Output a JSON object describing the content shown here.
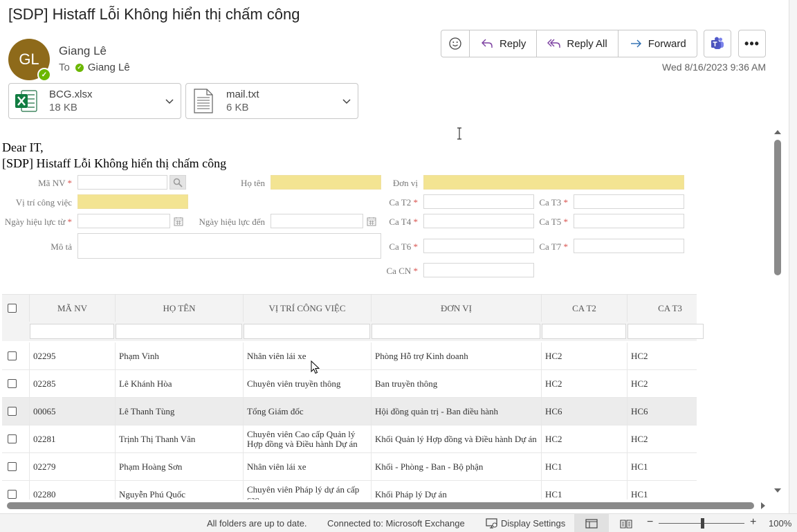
{
  "email": {
    "subject": "[SDP] Histaff Lỗi Không hiển thị chấm công",
    "avatar_initials": "GL",
    "sender": "Giang Lê",
    "to_label": "To",
    "to_name": "Giang Lê",
    "date": "Wed 8/16/2023 9:36 AM"
  },
  "actions": {
    "emoji_icon": "smiley-icon",
    "reply": "Reply",
    "reply_all": "Reply All",
    "forward": "Forward",
    "teams_icon": "teams-icon",
    "more": "•••"
  },
  "attachments": [
    {
      "name": "BCG.xlsx",
      "size": "18 KB",
      "icon": "excel-icon"
    },
    {
      "name": "mail.txt",
      "size": "6 KB",
      "icon": "text-file-icon"
    }
  ],
  "body": {
    "greeting": "Dear IT,",
    "subject_line": "[SDP] Histaff Lỗi Không hiển thị chấm công"
  },
  "form": {
    "ma_nv": "Mã NV",
    "ho_ten": "Họ tên",
    "don_vi": "Đơn vị",
    "vi_tri": "Vị trí công việc",
    "ca_t2": "Ca T2",
    "ca_t3": "Ca T3",
    "hieu_luc_tu": "Ngày hiệu lực từ",
    "hieu_luc_den": "Ngày hiệu lực đến",
    "ca_t4": "Ca T4",
    "ca_t5": "Ca T5",
    "mo_ta": "Mô tả",
    "ca_t6": "Ca T6",
    "ca_t7": "Ca T7",
    "ca_cn": "Ca CN",
    "required_mark": "*"
  },
  "grid": {
    "columns": [
      "MÃ NV",
      "HỌ TÊN",
      "VỊ TRÍ CÔNG VIỆC",
      "ĐƠN VỊ",
      "CA T2",
      "CA T3"
    ],
    "rows": [
      [
        "02295",
        "Phạm Vinh",
        "Nhân viên lái xe",
        "Phòng Hỗ trợ Kinh doanh",
        "HC2",
        "HC2"
      ],
      [
        "02285",
        "Lê Khánh Hòa",
        "Chuyên viên truyền thông",
        "Ban truyền thông",
        "HC2",
        "HC2"
      ],
      [
        "00065",
        "Lê Thanh Tùng",
        "Tổng Giám đốc",
        "Hội đồng quản trị - Ban điều hành",
        "HC6",
        "HC6"
      ],
      [
        "02281",
        "Trịnh Thị Thanh Vân",
        "Chuyên viên Cao cấp Quản lý Hợp đồng và Điều hành Dự án",
        "Khối Quản lý Hợp đồng và Điều hành Dự án",
        "HC2",
        "HC2"
      ],
      [
        "02279",
        "Phạm Hoàng Sơn",
        "Nhân viên lái xe",
        "Khối - Phòng - Ban - Bộ phận",
        "HC1",
        "HC1"
      ],
      [
        "02280",
        "Nguyễn Phú Quốc",
        "Chuyên viên Pháp lý dự án cấp cao",
        "Khối Pháp lý Dự án",
        "HC1",
        "HC1"
      ]
    ],
    "selected_row": 2
  },
  "status_bar": {
    "sync": "All folders are up to date.",
    "connection": "Connected to: Microsoft Exchange",
    "display_settings": "Display Settings",
    "zoom_minus": "−",
    "zoom_plus": "+",
    "zoom": "100%",
    "zoom_level": 1.0
  }
}
